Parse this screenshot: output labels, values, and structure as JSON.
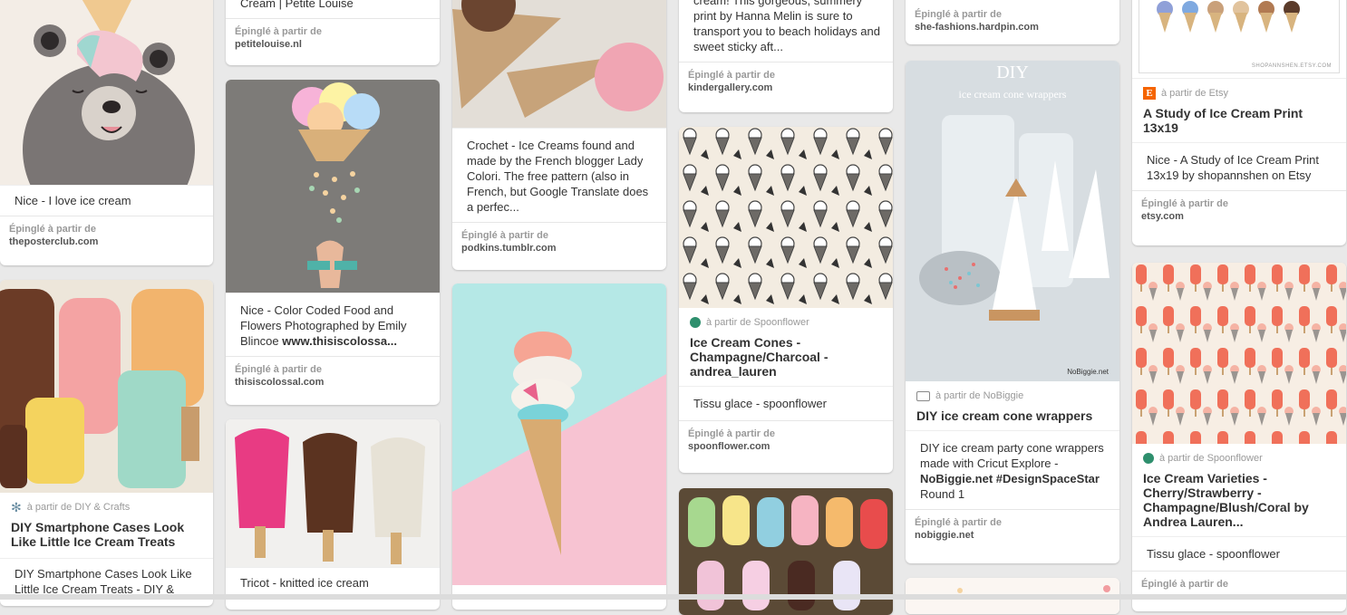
{
  "pins": {
    "c1p1": {
      "desc": "Nice - I love ice cream",
      "pinned_label": "Épinglé à partir de",
      "source": "theposterclub.com"
    },
    "c1p2": {
      "from": "à partir de DIY & Crafts",
      "title": "DIY Smartphone Cases Look Like Little Ice Cream Treats",
      "desc": "DIY Smartphone Cases Look Like Little Ice Cream Treats - DIY &"
    },
    "c2p1": {
      "top_text": "Cream | Petite Louise",
      "pinned_label": "Épinglé à partir de",
      "source": "petitelouise.nl"
    },
    "c2p2": {
      "desc": "Nice - Color Coded Food and Flowers Photographed by Emily Blincoe",
      "desc_bold": "www.thisiscolossa...",
      "pinned_label": "Épinglé à partir de",
      "source": "thisiscolossal.com"
    },
    "c2p3": {
      "desc": "Tricot - knitted ice cream"
    },
    "c3p1": {
      "desc": "Crochet - Ice Creams found and made by the French blogger Lady Colori.  The free pattern (also in French, but Google Translate does a perfec...",
      "pinned_label": "Épinglé à partir de",
      "source": "podkins.tumblr.com"
    },
    "c4p1": {
      "desc": "cream! This gorgeous, summery print by Hanna Melin is sure to transport you to beach holidays and sweet sticky aft...",
      "pinned_label": "Épinglé à partir de",
      "source": "kindergallery.com"
    },
    "c4p2": {
      "from": "à partir de Spoonflower",
      "title": "Ice Cream Cones - Champagne/Charcoal - andrea_lauren",
      "desc": "Tissu glace - spoonflower",
      "pinned_label": "Épinglé à partir de",
      "source": "spoonflower.com"
    },
    "c5p1": {
      "pinned_label": "Épinglé à partir de",
      "source": "she-fashions.hardpin.com"
    },
    "c5p2": {
      "img_title": "DIY",
      "img_sub": "ice cream cone wrappers",
      "img_credit": "NoBiggie.net",
      "from": "à partir de NoBiggie",
      "title": "DIY ice cream cone wrappers",
      "desc": "DIY ice cream party cone wrappers made with Cricut Explore -",
      "desc_bold": "NoBiggie.net #DesignSpaceStar",
      "desc_end": "Round 1",
      "pinned_label": "Épinglé à partir de",
      "source": "nobiggie.net"
    },
    "c6p1": {
      "img_credit": "SHOPANNSHEN.ETSY.COM",
      "from": "à partir de Etsy",
      "title": "A Study of Ice Cream Print 13x19",
      "desc": "Nice - A Study of Ice Cream Print 13x19 by shopannshen on Etsy",
      "pinned_label": "Épinglé à partir de",
      "source": "etsy.com"
    },
    "c6p2": {
      "from": "à partir de Spoonflower",
      "title": "Ice Cream Varieties - Cherry/Strawberry - Champagne/Blush/Coral by Andrea Lauren...",
      "desc": "Tissu glace - spoonflower",
      "pinned_label": "Épinglé à partir de"
    }
  },
  "icons": {
    "diy": "snowflake-icon",
    "spoonflower": "flower-icon",
    "nobiggie": "comment-icon",
    "etsy": "etsy-icon"
  },
  "colors": {
    "etsy": "#f56400",
    "page_bg": "#e9e9e9"
  }
}
